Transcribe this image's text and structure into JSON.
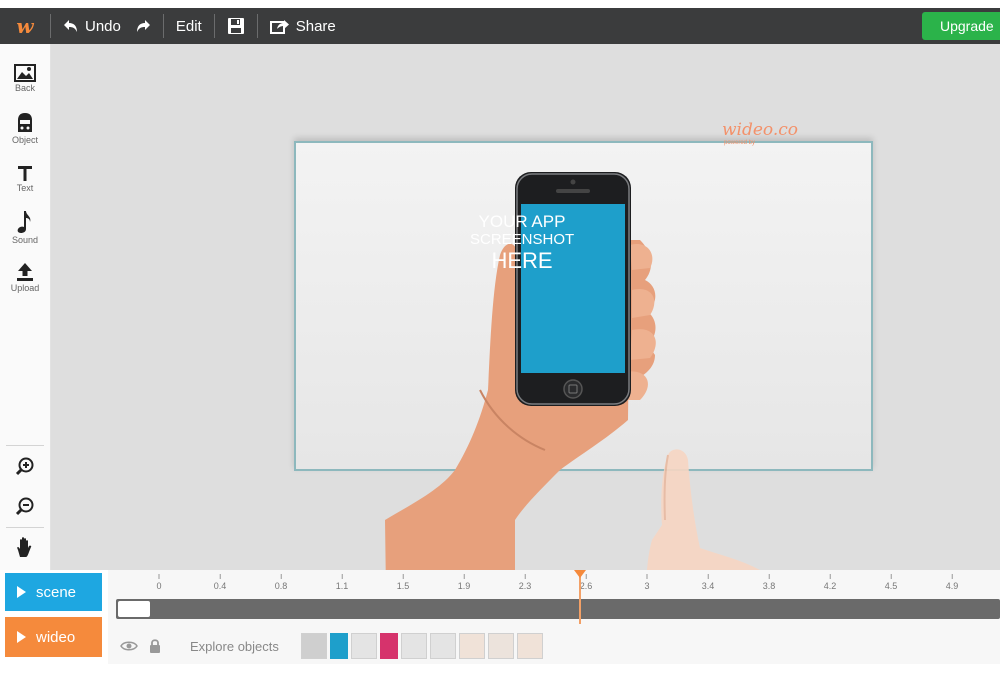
{
  "toolbar": {
    "logo": "w",
    "undo_label": "Undo",
    "edit_label": "Edit",
    "share_label": "Share",
    "upgrade_label": "Upgrade"
  },
  "sidebar": {
    "items": [
      {
        "label": "Back",
        "icon": "image-icon"
      },
      {
        "label": "Object",
        "icon": "object-icon"
      },
      {
        "label": "Text",
        "icon": "text-icon"
      },
      {
        "label": "Sound",
        "icon": "music-note-icon"
      },
      {
        "label": "Upload",
        "icon": "upload-icon"
      }
    ],
    "tools": [
      "zoom-in-icon",
      "zoom-out-icon",
      "hand-icon"
    ]
  },
  "canvas": {
    "brand": "wideo.co",
    "brand_sub": "powered by",
    "phone_line1": "YOUR APP",
    "phone_line2": "SCREENSHOT",
    "phone_line3": "HERE"
  },
  "modes": {
    "scene_label": "scene",
    "video_label": "wideo"
  },
  "timeline": {
    "ticks": [
      "0",
      "0.4",
      "0.8",
      "1.1",
      "1.5",
      "1.9",
      "2.3",
      "2.6",
      "3",
      "3.4",
      "3.8",
      "4.2",
      "4.5",
      "4.9"
    ],
    "playhead_value": "2.6",
    "explore_label": "Explore objects"
  },
  "colors": {
    "accent_orange": "#f58a3c",
    "accent_blue": "#1ea7e1",
    "upgrade_green": "#2bb34a",
    "toolbar_bg": "#3b3c3d"
  }
}
